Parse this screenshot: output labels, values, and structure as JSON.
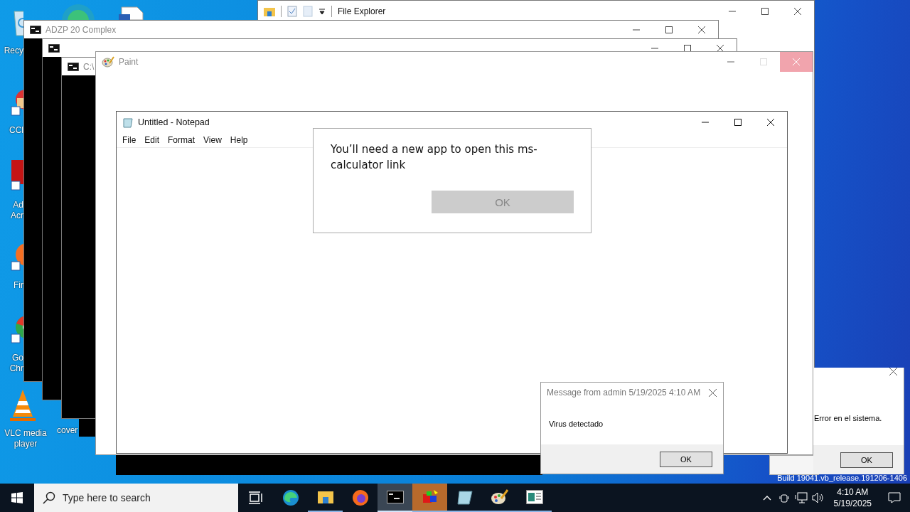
{
  "desktop_icons": [
    {
      "kind": "recycle",
      "label_lines": [
        "Recy"
      ]
    },
    {
      "kind": "ccleaner",
      "label_lines": [
        "CCl"
      ]
    },
    {
      "kind": "acrobat",
      "label_lines": [
        "Ad",
        "Acr"
      ]
    },
    {
      "kind": "firefox",
      "label_lines": [
        "Fir"
      ]
    },
    {
      "kind": "chrome",
      "label_lines": [
        "Go",
        "Chr"
      ]
    },
    {
      "kind": "vlc",
      "label_lines": [
        "VLC media",
        "player"
      ]
    },
    {
      "kind": "file",
      "label_lines": [
        "cover"
      ]
    }
  ],
  "file_explorer": {
    "title": "File Explorer"
  },
  "consoles": [
    {
      "kind": "console",
      "title": "ADZP 20 Complex"
    },
    {
      "kind": "console"
    },
    {
      "kind": "console",
      "title": "C:\\"
    }
  ],
  "paint": {
    "title": "Paint",
    "active": false
  },
  "notepad": {
    "title": "Untitled - Notepad",
    "menu": [
      "File",
      "Edit",
      "Format",
      "View",
      "Help"
    ]
  },
  "app_dialog": {
    "message": "You’ll need a new app to open this ms-calculator link",
    "button": "OK",
    "button_disabled": true
  },
  "message_box": {
    "title": "Message from admin 5/19/2025 4:10 AM",
    "message": "Virus detectado",
    "button": "OK"
  },
  "error_box": {
    "message": "Error en el sistema.",
    "button": "OK"
  },
  "build_info": "Build 19041.vb_release.191206-1406",
  "taskbar": {
    "search_placeholder": "Type here to search",
    "apps": [
      {
        "kind": "taskview",
        "open": false,
        "selected": false,
        "flashing": false
      },
      {
        "kind": "edge",
        "open": false,
        "selected": false,
        "flashing": false
      },
      {
        "kind": "explorer",
        "open": true,
        "selected": false,
        "flashing": false
      },
      {
        "kind": "firefox",
        "open": false,
        "selected": false,
        "flashing": false
      },
      {
        "kind": "console",
        "open": true,
        "selected": true,
        "flashing": false
      },
      {
        "kind": "shapes",
        "open": true,
        "selected": false,
        "flashing": true
      },
      {
        "kind": "notepad",
        "open": true,
        "selected": false,
        "flashing": false
      },
      {
        "kind": "paint",
        "open": true,
        "selected": false,
        "flashing": false
      },
      {
        "kind": "app",
        "open": true,
        "selected": false,
        "flashing": false
      }
    ],
    "time": "4:10 AM",
    "date": "5/19/2025"
  }
}
